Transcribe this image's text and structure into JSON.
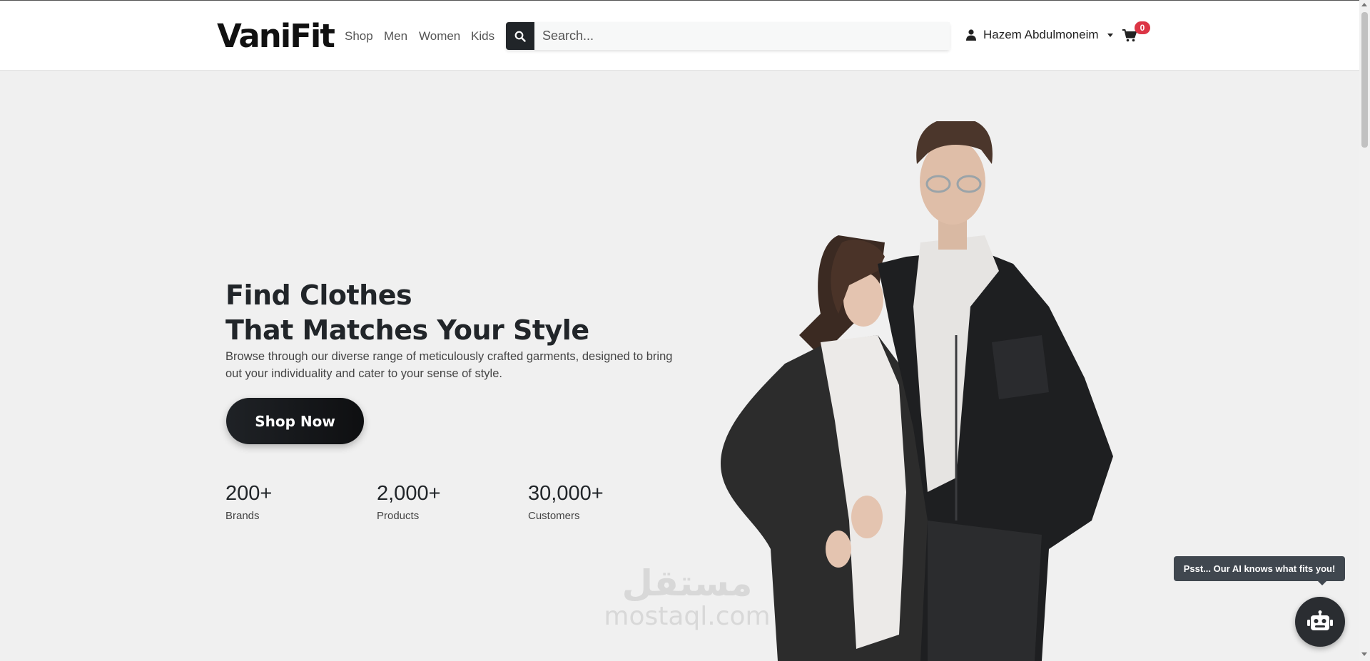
{
  "navbar": {
    "brand": "VaniFit",
    "links": [
      "Shop",
      "Men",
      "Women",
      "Kids"
    ],
    "search": {
      "placeholder": "Search...",
      "icon": "search-icon"
    },
    "user": {
      "name": "Hazem Abdulmoneim",
      "icon": "user-icon"
    },
    "cart": {
      "count": "0",
      "icon": "cart-icon"
    }
  },
  "hero": {
    "title_line1": "Find Clothes",
    "title_line2": "That Matches Your Style",
    "description": "Browse through our diverse range of meticulously crafted garments, designed to bring out your individuality and cater to your sense of style.",
    "cta_label": "Shop Now",
    "stats": [
      {
        "value": "200+",
        "label": "Brands"
      },
      {
        "value": "2,000+",
        "label": "Products"
      },
      {
        "value": "30,000+",
        "label": "Customers"
      }
    ]
  },
  "watermark": {
    "arabic": "مستقل",
    "latin": "mostaql.com"
  },
  "chat": {
    "tooltip": "Psst... Our AI knows what fits you!",
    "icon": "robot-icon"
  },
  "colors": {
    "primary": "#212529",
    "badge": "#dc3545",
    "background": "#f0f0f0"
  }
}
